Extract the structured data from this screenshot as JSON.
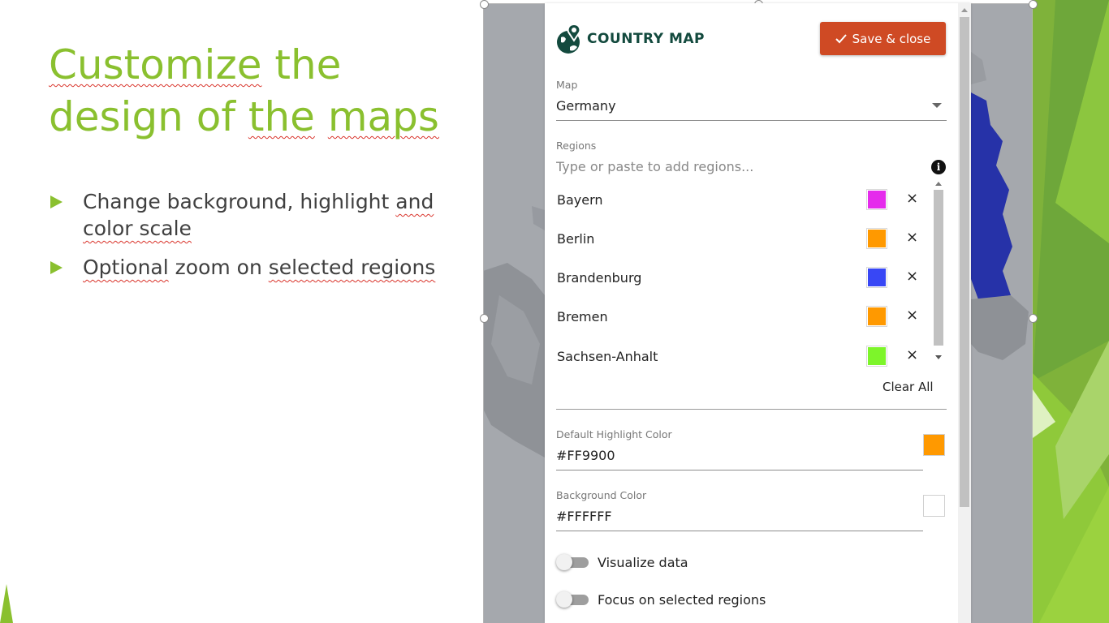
{
  "slide": {
    "title_line1_a": "Customize",
    "title_line1_b": " the",
    "title_line2_a": "design of ",
    "title_line2_b": "the",
    "title_line2_c": " ",
    "title_line2_d": "maps",
    "bullet1_a": "Change background, highlight ",
    "bullet1_b": "and",
    "bullet1_c": " ",
    "bullet1_d": "color scale",
    "bullet2_a": "Optional",
    "bullet2_b": " zoom on ",
    "bullet2_c": "selected regions"
  },
  "panel": {
    "logo_text": "COUNTRY MAP",
    "save_label": "Save & close",
    "map_label": "Map",
    "map_value": "Germany",
    "regions_label": "Regions",
    "regions_placeholder": "Type or paste to add regions...",
    "info_icon": "i",
    "regions": [
      {
        "name": "Bayern",
        "color": "#E52BEC"
      },
      {
        "name": "Berlin",
        "color": "#FF9900"
      },
      {
        "name": "Brandenburg",
        "color": "#3847F5"
      },
      {
        "name": "Bremen",
        "color": "#FF9900"
      },
      {
        "name": "Sachsen-Anhalt",
        "color": "#7DF52A"
      }
    ],
    "remove_symbol": "×",
    "clear_all_label": "Clear All",
    "highlight_label": "Default Highlight Color",
    "highlight_value": "#FF9900",
    "background_label": "Background Color",
    "background_value": "#FFFFFF",
    "toggle_visualize_label": "Visualize data",
    "toggle_visualize_on": false,
    "toggle_focus_label": "Focus on selected regions",
    "toggle_focus_on": false
  },
  "colors": {
    "accent_green": "#8AC02F",
    "save_button": "#CF4A24",
    "logo_dark": "#134A3E",
    "map_selected": "#2632A8"
  }
}
